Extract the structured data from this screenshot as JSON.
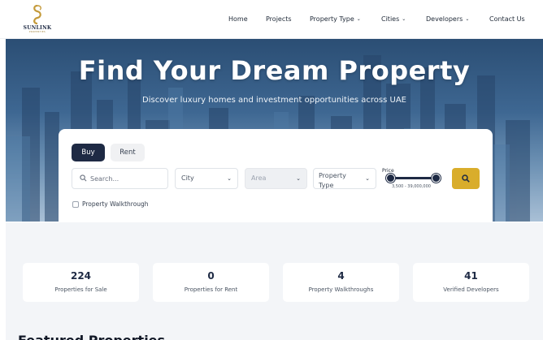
{
  "brand": {
    "name": "SUNLINK",
    "tagline": "PROPERTIES"
  },
  "nav": [
    {
      "label": "Home",
      "dropdown": false
    },
    {
      "label": "Projects",
      "dropdown": false
    },
    {
      "label": "Property Type",
      "dropdown": true
    },
    {
      "label": "Cities",
      "dropdown": true
    },
    {
      "label": "Developers",
      "dropdown": true
    },
    {
      "label": "Contact Us",
      "dropdown": false
    }
  ],
  "hero": {
    "title": "Find Your Dream Property",
    "subtitle": "Discover luxury homes and investment opportunities across UAE"
  },
  "search": {
    "tabs": [
      {
        "label": "Buy",
        "active": true
      },
      {
        "label": "Rent",
        "active": false
      }
    ],
    "keyword_placeholder": "Search...",
    "city": "City",
    "area": "Area",
    "property_type": "Property Type",
    "price_label": "Price",
    "price_range": "3,500 - 39,000,000",
    "walkthrough_label": "Property Walkthrough",
    "walkthrough_checked": false
  },
  "stats": [
    {
      "value": "224",
      "label": "Properties for Sale"
    },
    {
      "value": "0",
      "label": "Properties for Rent"
    },
    {
      "value": "4",
      "label": "Property Walkthroughs"
    },
    {
      "value": "41",
      "label": "Verified Developers"
    }
  ],
  "featured": {
    "title": "Featured Properties"
  },
  "colors": {
    "navy": "#1e2a44",
    "gold": "#d9ad2b",
    "hero_sky": "#3e6792"
  },
  "icons": {
    "search": "search-icon",
    "dropdown": "chevron-down-icon",
    "logo": "sunlink-logo-icon"
  }
}
